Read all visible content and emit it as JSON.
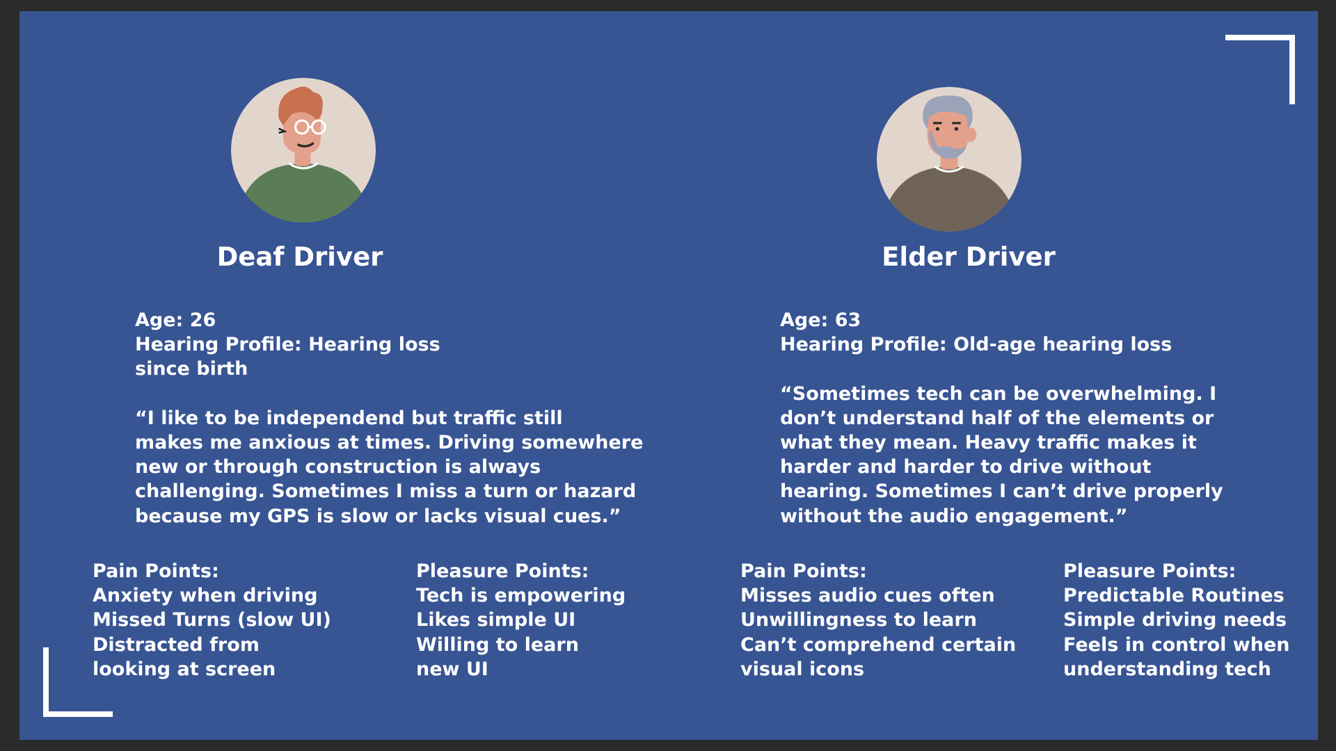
{
  "personas": [
    {
      "title": "Deaf Driver",
      "age_line": "Age: 26",
      "hearing_lines": [
        "Hearing Profile: Hearing loss",
        "since birth"
      ],
      "quote_lines": [
        "“I like to be independend but traffic still",
        "makes me anxious at times. Driving somewhere",
        "new or through construction is always",
        "challenging. Sometimes I miss a turn or hazard",
        "because my GPS is slow or lacks visual cues.”"
      ],
      "pain": {
        "heading": "Pain Points:",
        "lines": [
          "Anxiety when driving",
          "Missed Turns (slow UI)",
          "Distracted from",
          "looking at screen"
        ]
      },
      "pleasure": {
        "heading": "Pleasure Points:",
        "lines": [
          "Tech is empowering",
          "Likes simple UI",
          "Willing to learn",
          "new UI"
        ]
      }
    },
    {
      "title": "Elder Driver",
      "age_line": "Age: 63",
      "hearing_lines": [
        "Hearing Profile: Old-age hearing loss"
      ],
      "quote_lines": [
        "“Sometimes tech can be overwhelming. I",
        "don’t understand half of the elements or",
        "what they mean. Heavy traffic makes it",
        "harder and harder to drive without",
        "hearing. Sometimes I can’t drive properly",
        "without the audio engagement.”"
      ],
      "pain": {
        "heading": "Pain Points:",
        "lines": [
          "Misses audio cues often",
          "Unwillingness to learn",
          "Can’t comprehend certain",
          "visual icons"
        ]
      },
      "pleasure": {
        "heading": "Pleasure Points:",
        "lines": [
          "Predictable Routines",
          "Simple driving needs",
          "Feels in control when",
          "understanding tech"
        ]
      }
    }
  ],
  "colors": {
    "slide_bg": "#375493",
    "frame_bg": "#2b2b2b",
    "text": "#ffffff",
    "avatar_bg": "#e2d6cc",
    "deaf_shirt": "#5a7d56",
    "deaf_hair": "#c9704e",
    "elder_shirt": "#6f6457",
    "elder_hair": "#9aa3b8"
  }
}
